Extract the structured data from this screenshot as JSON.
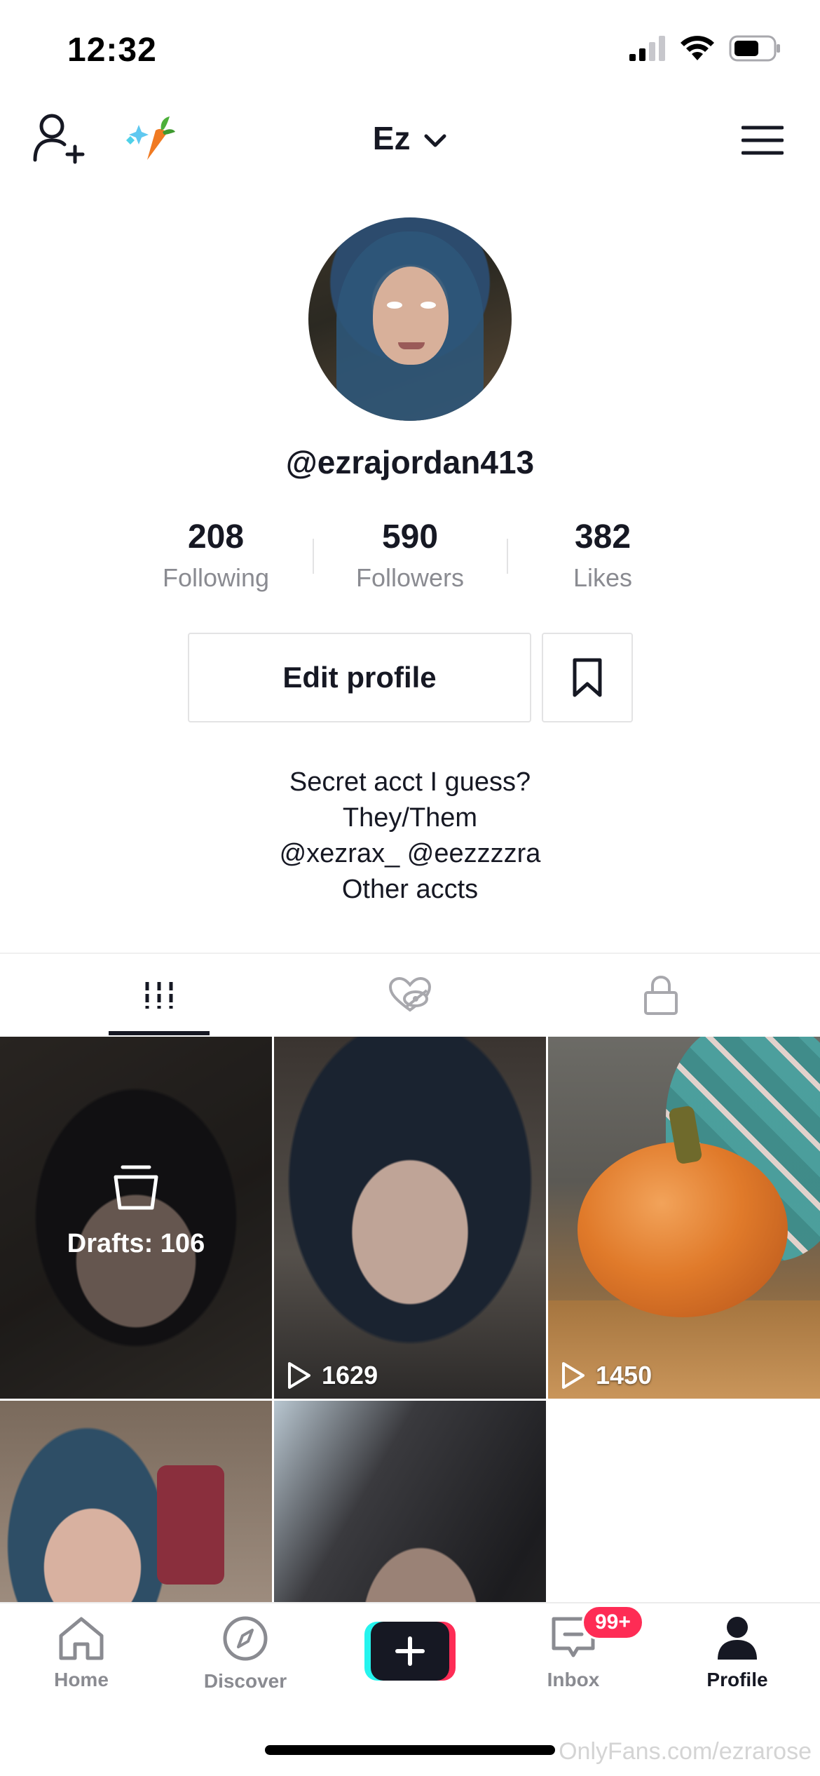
{
  "status_bar": {
    "time": "12:32"
  },
  "header": {
    "account_name": "Ez"
  },
  "profile": {
    "handle": "@ezrajordan413",
    "stats": [
      {
        "value": "208",
        "label": "Following"
      },
      {
        "value": "590",
        "label": "Followers"
      },
      {
        "value": "382",
        "label": "Likes"
      }
    ],
    "edit_profile_label": "Edit profile",
    "bio_lines": [
      "Secret acct I guess?",
      "They/Them",
      "@xezrax_ @eezzzzra",
      "Other accts"
    ]
  },
  "tabs": {
    "active": "videos",
    "items": [
      "videos-grid-icon",
      "liked-hidden-icon",
      "private-lock-icon"
    ]
  },
  "videos": {
    "drafts_label": "Drafts: 106",
    "items": [
      {
        "views": "1629"
      },
      {
        "views": "1450"
      }
    ]
  },
  "bottom_nav": {
    "items": [
      {
        "label": "Home",
        "icon": "home-icon"
      },
      {
        "label": "Discover",
        "icon": "compass-icon"
      },
      {
        "label": "",
        "icon": "plus-icon"
      },
      {
        "label": "Inbox",
        "icon": "inbox-icon"
      },
      {
        "label": "Profile",
        "icon": "profile-icon"
      }
    ],
    "inbox_badge": "99+",
    "active": "Profile"
  },
  "watermark": "OnlyFans.com/ezrarose",
  "colors": {
    "accent_red": "#fe2c55",
    "accent_cyan": "#25f4ee",
    "text_primary": "#161823",
    "text_secondary": "#8a8b91"
  }
}
